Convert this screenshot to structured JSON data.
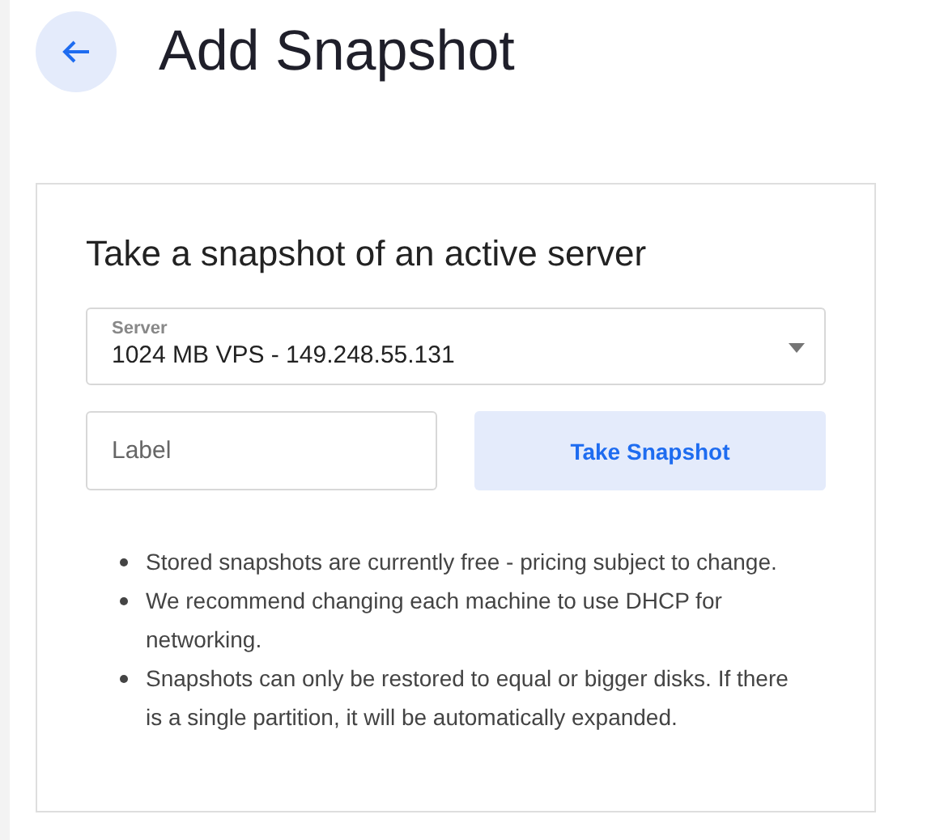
{
  "page": {
    "title": "Add Snapshot"
  },
  "card": {
    "heading": "Take a snapshot of an active server",
    "server_select": {
      "label": "Server",
      "value": "1024 MB VPS - 149.248.55.131"
    },
    "label_field": {
      "placeholder": "Label"
    },
    "button": "Take Snapshot",
    "notes": [
      "Stored snapshots are currently free - pricing subject to change.",
      "We recommend changing each machine to use DHCP for networking.",
      "Snapshots can only be restored to equal or bigger disks. If there is a single partition, it will be automatically expanded."
    ]
  }
}
